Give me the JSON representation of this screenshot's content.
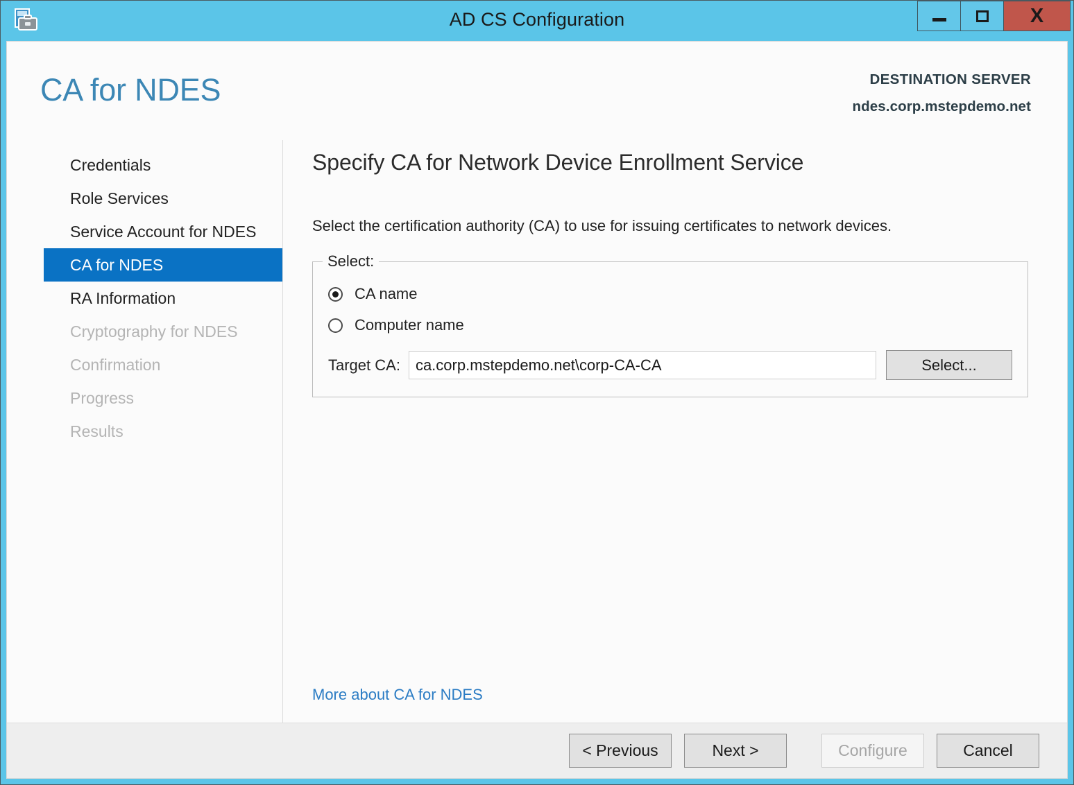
{
  "window": {
    "title": "AD CS Configuration",
    "icon": "server-manager-icon",
    "controls": {
      "minimize": "minimize-icon",
      "maximize": "maximize-icon",
      "close": "X"
    },
    "frame_color": "#5bc5e8",
    "close_color": "#c0564b"
  },
  "header": {
    "page_title": "CA for NDES",
    "destination_label": "DESTINATION SERVER",
    "destination_server": "ndes.corp.mstepdemo.net",
    "title_color": "#3c87b5"
  },
  "sidebar": {
    "items": [
      {
        "label": "Credentials",
        "state": "enabled"
      },
      {
        "label": "Role Services",
        "state": "enabled"
      },
      {
        "label": "Service Account for NDES",
        "state": "enabled"
      },
      {
        "label": "CA for NDES",
        "state": "selected"
      },
      {
        "label": "RA Information",
        "state": "enabled"
      },
      {
        "label": "Cryptography for NDES",
        "state": "disabled"
      },
      {
        "label": "Confirmation",
        "state": "disabled"
      },
      {
        "label": "Progress",
        "state": "disabled"
      },
      {
        "label": "Results",
        "state": "disabled"
      }
    ],
    "selected_color": "#0a72c4"
  },
  "main": {
    "heading": "Specify CA for Network Device Enrollment Service",
    "description": "Select the certification authority (CA) to use for issuing certificates to network devices.",
    "groupbox": {
      "legend": "Select:",
      "radios": [
        {
          "label": "CA name",
          "checked": true
        },
        {
          "label": "Computer name",
          "checked": false
        }
      ],
      "target_ca_label": "Target CA:",
      "target_ca_value": "ca.corp.mstepdemo.net\\corp-CA-CA",
      "target_ca_placeholder": "",
      "select_button": "Select..."
    },
    "more_link": "More about CA for NDES"
  },
  "footer": {
    "previous": "< Previous",
    "next": "Next >",
    "configure": "Configure",
    "cancel": "Cancel",
    "configure_enabled": false
  }
}
